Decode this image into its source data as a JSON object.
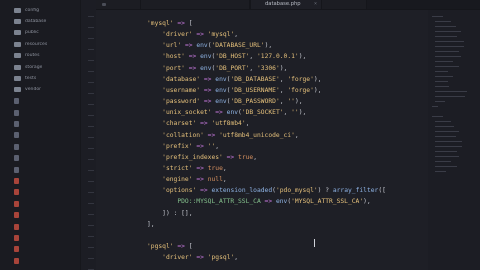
{
  "tabs": [
    {
      "label": ""
    },
    {
      "label": ""
    },
    {
      "label": "database.php"
    },
    {
      "label": ""
    }
  ],
  "sidebar": {
    "items": [
      {
        "label": "config",
        "kind": "folder"
      },
      {
        "label": "database",
        "kind": "folder"
      },
      {
        "label": "public",
        "kind": "folder"
      },
      {
        "label": "resources",
        "kind": "folder"
      },
      {
        "label": "routes",
        "kind": "folder"
      },
      {
        "label": "storage",
        "kind": "folder"
      },
      {
        "label": "tests",
        "kind": "folder"
      },
      {
        "label": "vendor",
        "kind": "folder"
      },
      {
        "label": "",
        "kind": "file"
      },
      {
        "label": "",
        "kind": "file"
      },
      {
        "label": "",
        "kind": "file"
      },
      {
        "label": "",
        "kind": "file"
      },
      {
        "label": "",
        "kind": "file"
      },
      {
        "label": "",
        "kind": "file"
      },
      {
        "label": "",
        "kind": "file"
      },
      {
        "label": "",
        "kind": "red"
      },
      {
        "label": "",
        "kind": "red"
      },
      {
        "label": "",
        "kind": "red"
      },
      {
        "label": "",
        "kind": "red"
      },
      {
        "label": "",
        "kind": "red"
      },
      {
        "label": "",
        "kind": "red"
      },
      {
        "label": "",
        "kind": "red"
      },
      {
        "label": "",
        "kind": "red"
      }
    ]
  },
  "code": {
    "lines": [
      "'mysql' => [",
      "    'driver' => 'mysql',",
      "    'url' => env('DATABASE_URL'),",
      "    'host' => env('DB_HOST', '127.0.0.1'),",
      "    'port' => env('DB_PORT', '3306'),",
      "    'database' => env('DB_DATABASE', 'forge'),",
      "    'username' => env('DB_USERNAME', 'forge'),",
      "    'password' => env('DB_PASSWORD', ''),",
      "    'unix_socket' => env('DB_SOCKET', ''),",
      "    'charset' => 'utf8mb4',",
      "    'collation' => 'utf8mb4_unicode_ci',",
      "    'prefix' => '',",
      "    'prefix_indexes' => true,",
      "    'strict' => true,",
      "    'engine' => null,",
      "    'options' => extension_loaded('pdo_mysql') ? array_filter([",
      "        PDO::MYSQL_ATTR_SSL_CA => env('MYSQL_ATTR_SSL_CA'),",
      "    ]) : [],",
      "],",
      "",
      "'pgsql' => [",
      "    'driver' => 'pgsql',"
    ]
  },
  "colors": {
    "string": "#e5c07b",
    "operator": "#c678dd",
    "function": "#8fb4e6",
    "boolean": "#d58f5e",
    "constant": "#84c08c"
  }
}
